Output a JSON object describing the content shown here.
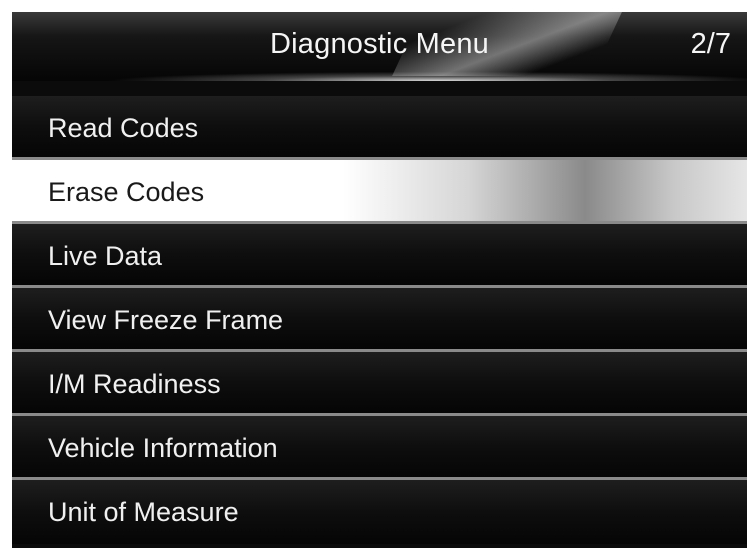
{
  "header": {
    "title": "Diagnostic Menu",
    "page": "2/7"
  },
  "menu": {
    "selected_index": 1,
    "items": [
      {
        "label": "Read Codes"
      },
      {
        "label": "Erase Codes"
      },
      {
        "label": "Live Data"
      },
      {
        "label": "View Freeze Frame"
      },
      {
        "label": "I/M Readiness"
      },
      {
        "label": "Vehicle Information"
      },
      {
        "label": "Unit of Measure"
      }
    ]
  },
  "colors": {
    "background": "#0b0b0b",
    "selected_background": "#ffffff",
    "text": "#f0f0f0",
    "selected_text": "#1a1a1a",
    "separator": "#8a8a8a"
  }
}
